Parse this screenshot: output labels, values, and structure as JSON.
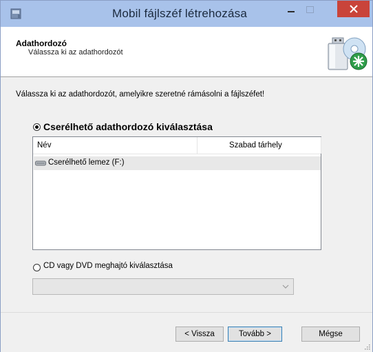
{
  "window": {
    "title": "Mobil fájlszéf létrehozása",
    "titlebar_color": "#a8c2ea",
    "close_color": "#c9443a"
  },
  "header": {
    "title": "Adathordozó",
    "subtitle": "Válassza ki az adathordozót",
    "graphic_icon": "usb-disc-add-icon"
  },
  "body": {
    "intro": "Válassza ki az adathordozót, amelyikre szeretné rámásolni a fájlszéfet!",
    "option_removable": {
      "label": "Cserélhető adathordozó kiválasztása",
      "selected": true
    },
    "list": {
      "columns": [
        "Név",
        "Szabad tárhely"
      ],
      "rows": [
        {
          "name": "Cserélhető lemez (F:)",
          "free": "",
          "icon": "removable-drive-icon"
        }
      ]
    },
    "option_cd": {
      "label": "CD vagy DVD meghajtó kiválasztása",
      "selected": false,
      "dropdown_value": ""
    }
  },
  "footer": {
    "back_label": "< Vissza",
    "next_label": "Tovább >",
    "cancel_label": "Mégse"
  }
}
